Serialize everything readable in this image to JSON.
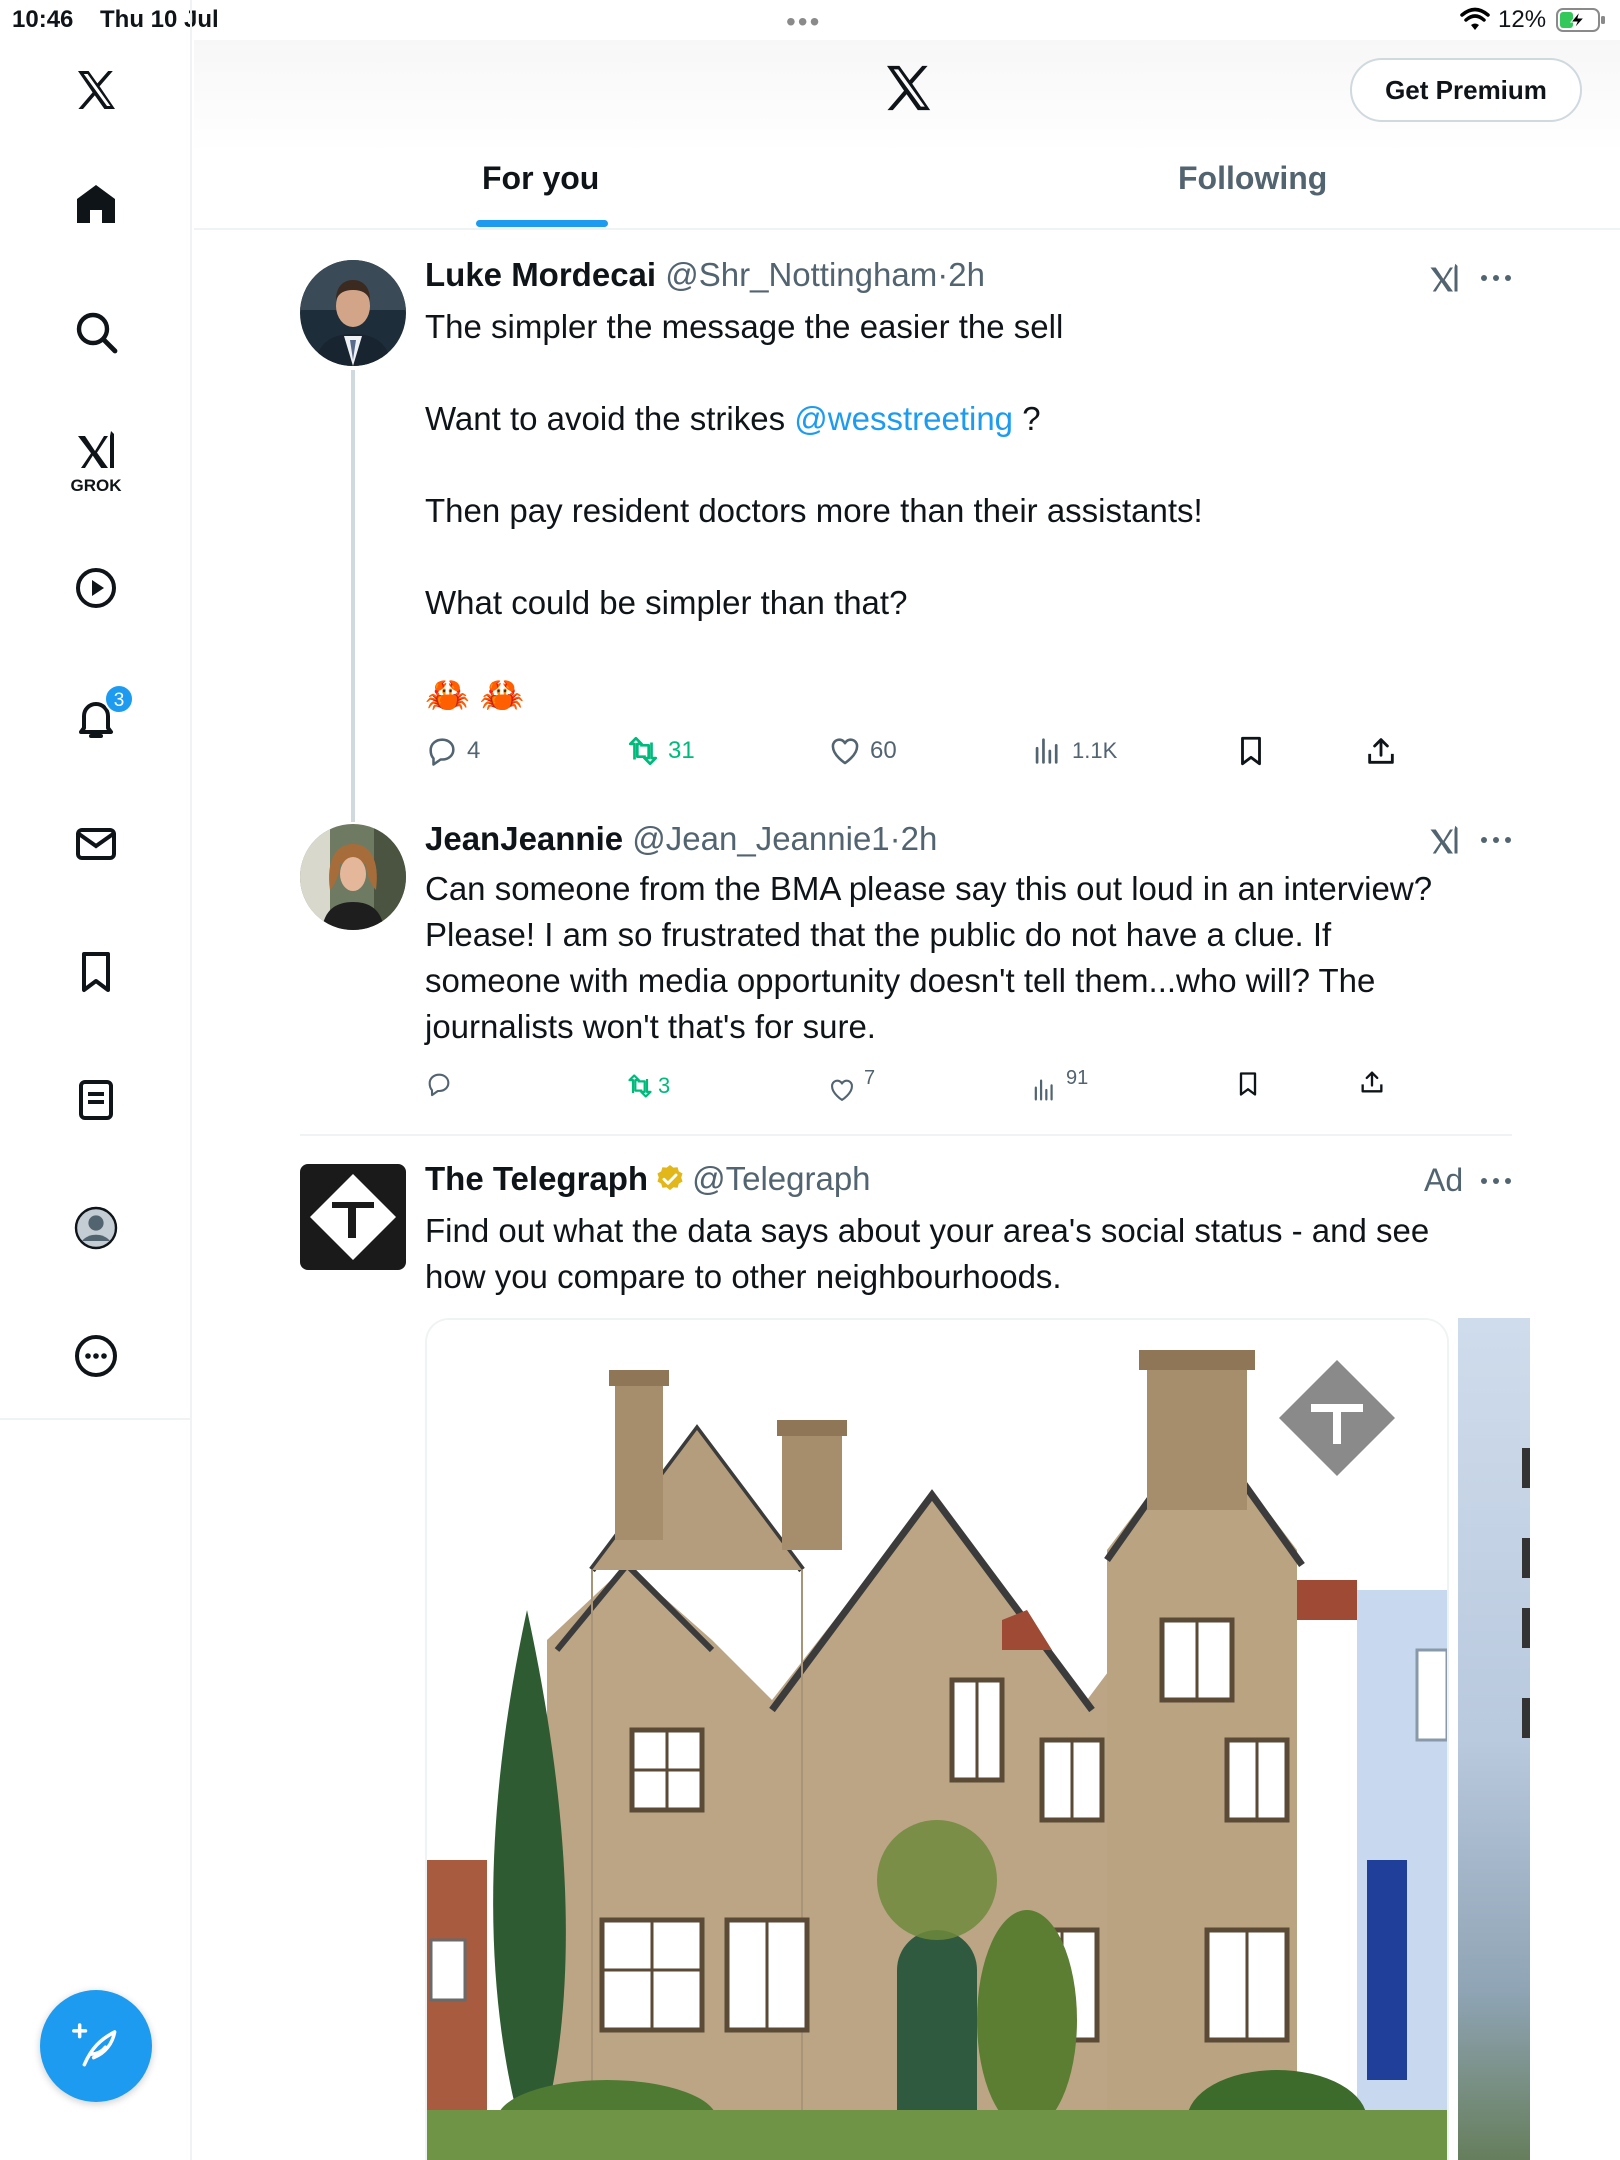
{
  "status_bar": {
    "time": "10:46",
    "date": "Thu 10 Jul",
    "battery_pct": "12%",
    "battery_level": 0.12
  },
  "sidebar": {
    "items": [
      {
        "icon": "x-logo-icon"
      },
      {
        "icon": "home-icon"
      },
      {
        "icon": "search-icon"
      },
      {
        "icon": "grok-icon",
        "label": "GROK"
      },
      {
        "icon": "video-play-icon"
      },
      {
        "icon": "notifications-bell-icon",
        "badge": "3"
      },
      {
        "icon": "messages-envelope-icon"
      },
      {
        "icon": "bookmark-icon"
      },
      {
        "icon": "lists-icon"
      },
      {
        "icon": "profile-icon"
      },
      {
        "icon": "more-circle-icon"
      }
    ],
    "compose_icon": "compose-feather-icon"
  },
  "header": {
    "logo": "x-logo-icon",
    "premium_label": "Get Premium",
    "tabs": [
      {
        "label": "For you",
        "active": true
      },
      {
        "label": "Following",
        "active": false
      }
    ]
  },
  "tweets": [
    {
      "name": "Luke Mordecai",
      "handle": "@Shr_Nottingham",
      "sep": "·",
      "time": "2h",
      "lines": [
        "The simpler the message the easier the sell",
        "Want to avoid the strikes ",
        "@wesstreeting",
        " ?",
        "Then pay resident doctors more than their assistants!",
        "What could be simpler than that?",
        "🦀 🦀"
      ],
      "stats": {
        "replies": "4",
        "reposts": "31",
        "likes": "60",
        "views": "1.1K"
      }
    },
    {
      "name": "JeanJeannie",
      "handle": "@Jean_Jeannie1",
      "sep": "·",
      "time": "2h",
      "lines": [
        "Can someone from the BMA please say this out loud in an interview?",
        "Please! I am so frustrated that the public do not have a clue. If",
        "someone with media opportunity doesn't tell them...who will? The",
        "journalists won't that's for sure."
      ],
      "stats": {
        "replies": "",
        "reposts": "3",
        "likes": "7",
        "views": "91"
      }
    },
    {
      "name": "The Telegraph",
      "handle": "@Telegraph",
      "ad_label": "Ad",
      "lines": [
        "Find out what the data says about your area's social status - and see",
        "how you compare to other neighbourhoods."
      ]
    }
  ],
  "colors": {
    "accent": "#1d9bf0",
    "repost_green": "#00ba7c",
    "muted_text": "#536471",
    "text": "#0f1419",
    "verified_gold": "#e2b719"
  }
}
